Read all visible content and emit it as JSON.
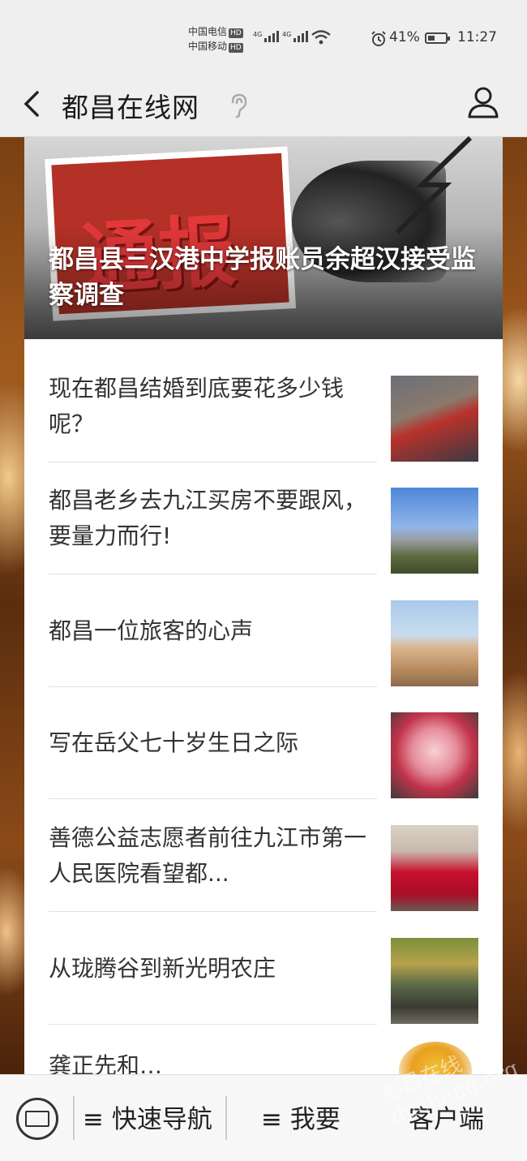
{
  "status_bar": {
    "carrier_1": "中国电信",
    "carrier_2": "中国移动",
    "hd_badge": "HD",
    "network": "4G",
    "battery_level": 41,
    "battery": "41%",
    "time": "11:27"
  },
  "nav": {
    "title": "都昌在线网"
  },
  "hero": {
    "caption": "都昌县三汉港中学报账员余超汉接受监察调查"
  },
  "articles": [
    {
      "title": "现在都昌结婚到底要花多少钱呢？"
    },
    {
      "title": "都昌老乡去九江买房不要跟风，要量力而行!"
    },
    {
      "title": "都昌一位旅客的心声"
    },
    {
      "title": "写在岳父七十岁生日之际"
    },
    {
      "title": "善德公益志愿者前往九江市第一人民医院看望都..."
    },
    {
      "title": "从珑腾谷到新光明农庄"
    },
    {
      "title": "龚正先和…"
    }
  ],
  "bottom_bar": {
    "nav_label": "≡ 快速导航",
    "want_label": "≡ 我要",
    "client_label": "客户端"
  },
  "watermark": "都昌在线 duchang.org"
}
